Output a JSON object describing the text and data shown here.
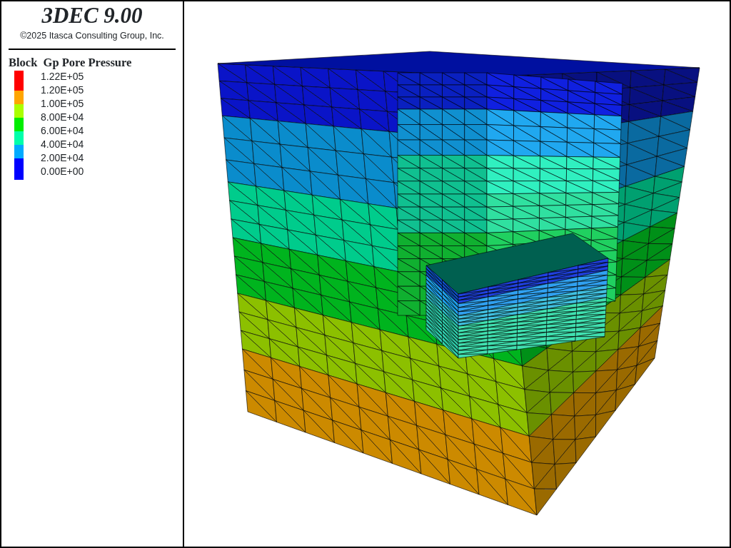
{
  "header": {
    "title": "3DEC 9.00",
    "copyright": "©2025 Itasca Consulting Group, Inc."
  },
  "legend": {
    "title": "Block  Gp Pore Pressure",
    "labels": [
      "1.22E+05",
      "1.20E+05",
      "1.00E+05",
      "8.00E+04",
      "6.00E+04",
      "4.00E+04",
      "2.00E+04",
      "0.00E+00"
    ],
    "bands": [
      {
        "color": "#ff0000"
      },
      {
        "color": "#ffa500"
      },
      {
        "color": "#aaff00"
      },
      {
        "color": "#00ee00"
      },
      {
        "color": "#00ffaa"
      },
      {
        "color": "#00aaff"
      },
      {
        "color": "#0000ff"
      }
    ]
  }
}
